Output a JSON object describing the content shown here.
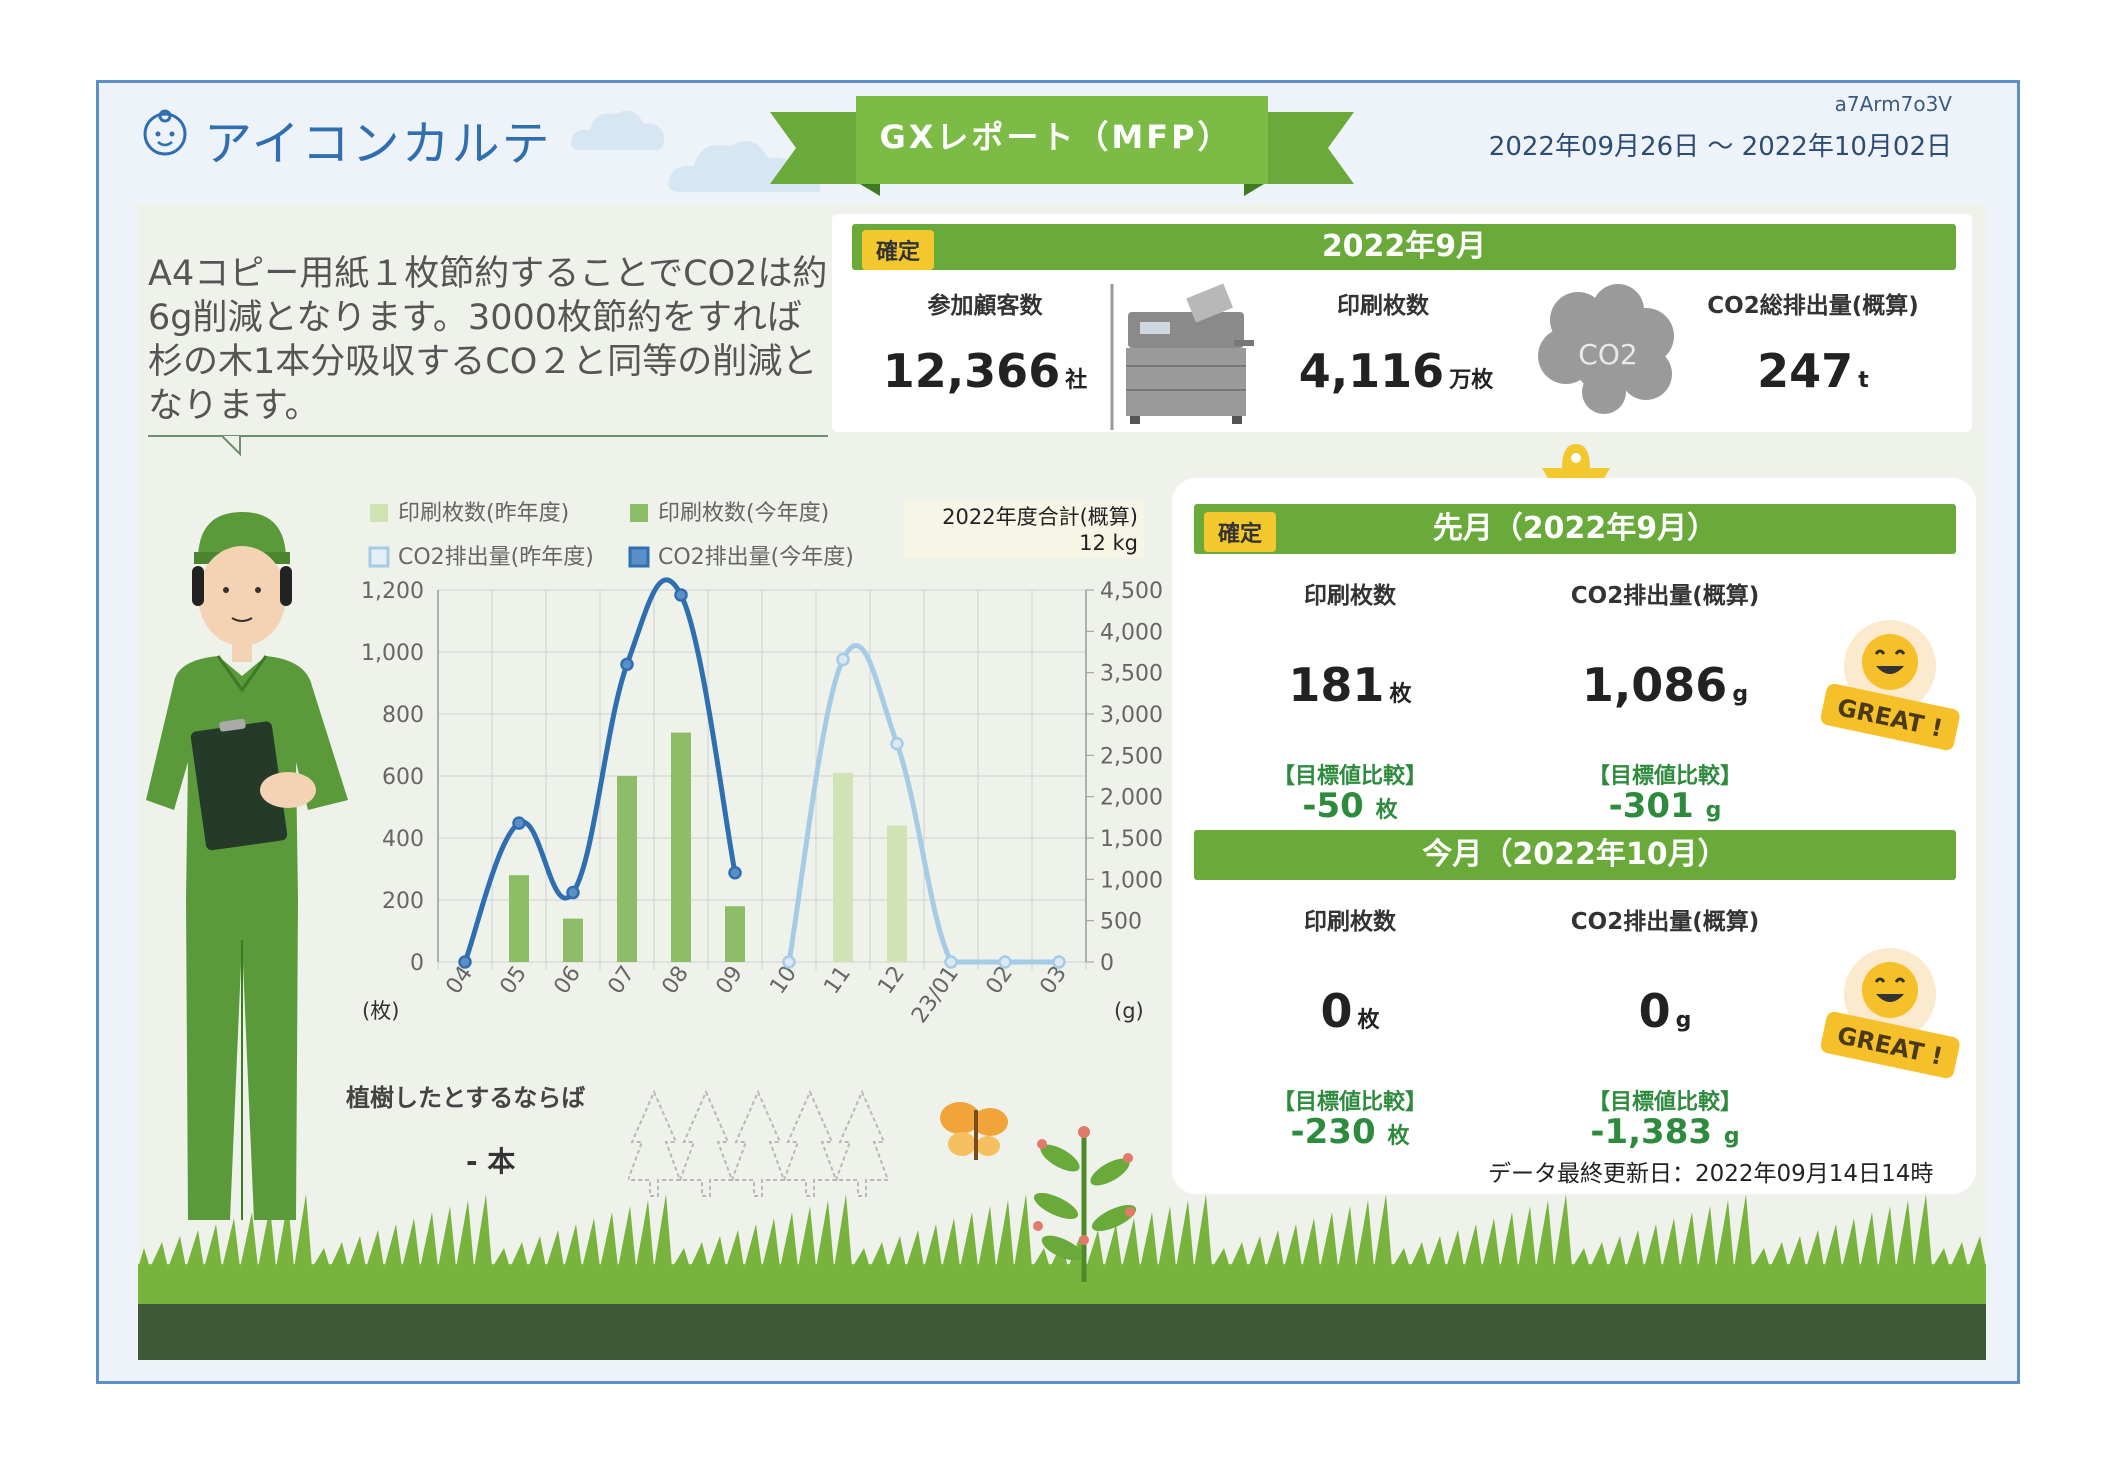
{
  "header": {
    "brand": "アイコンカルテ",
    "report_title": "GXレポート（MFP）",
    "report_id": "a7Arm7o3V",
    "date_range": "2022年09月26日 〜 2022年10月02日"
  },
  "message": "A4コピー用紙１枚節約することでCO2は約6g削減となります。3000枚節約をすれば杉の木1本分吸収するCO２と同等の削減となります。",
  "summary": {
    "badge": "確定",
    "period": "2022年9月",
    "customers_label": "参加顧客数",
    "customers_value": "12,366",
    "customers_unit": "社",
    "prints_label": "印刷枚数",
    "prints_value": "4,116",
    "prints_unit": "万枚",
    "co2_label": "CO2総排出量(概算)",
    "co2_value": "247",
    "co2_unit": "t",
    "cloud_text": "CO2"
  },
  "chart": {
    "legend": [
      "印刷枚数(昨年度)",
      "印刷枚数(今年度)",
      "CO2排出量(昨年度)",
      "CO2排出量(今年度)"
    ],
    "total_label": "2022年度合計(概算)",
    "total_value": "12 kg",
    "left_unit": "(枚)",
    "right_unit": "(g)",
    "colors": {
      "bar_prev": "#cfe3b4",
      "bar_curr": "#8dbd67",
      "line_prev": "#a6cbe6",
      "line_curr": "#2f6fb0"
    }
  },
  "chart_data": {
    "type": "bar",
    "categories": [
      "04",
      "05",
      "06",
      "07",
      "08",
      "09",
      "10",
      "11",
      "12",
      "23/01",
      "02",
      "03"
    ],
    "series": [
      {
        "name": "印刷枚数(昨年度)",
        "type": "bar",
        "axis": "left",
        "values": [
          null,
          null,
          null,
          null,
          null,
          null,
          null,
          610,
          440,
          null,
          null,
          null
        ]
      },
      {
        "name": "印刷枚数(今年度)",
        "type": "bar",
        "axis": "left",
        "values": [
          null,
          280,
          140,
          600,
          740,
          180,
          null,
          null,
          null,
          null,
          null,
          null
        ]
      },
      {
        "name": "CO2排出量(昨年度)",
        "type": "line",
        "axis": "right",
        "values": [
          null,
          null,
          null,
          null,
          null,
          null,
          0,
          3660,
          2640,
          0,
          0,
          0
        ]
      },
      {
        "name": "CO2排出量(今年度)",
        "type": "line",
        "axis": "right",
        "values": [
          0,
          1680,
          840,
          3600,
          4440,
          1080,
          null,
          null,
          null,
          null,
          null,
          null
        ]
      }
    ],
    "ylim_left": [
      0,
      1200
    ],
    "yticks_left": [
      "0",
      "200",
      "400",
      "600",
      "800",
      "1,000",
      "1,200"
    ],
    "ylim_right": [
      0,
      4500
    ],
    "yticks_right": [
      "0",
      "500",
      "1,000",
      "1,500",
      "2,000",
      "2,500",
      "3,000",
      "3,500",
      "4,000",
      "4,500"
    ],
    "grid": true
  },
  "trees": {
    "label": "植樹したとするならば",
    "value": "- 本"
  },
  "last_month": {
    "badge": "確定",
    "title": "先月（2022年9月）",
    "prints_label": "印刷枚数",
    "prints_value": "181",
    "prints_unit": "枚",
    "co2_label": "CO2排出量(概算)",
    "co2_value": "1,086",
    "co2_unit": "g",
    "cmp_label": "【目標値比較】",
    "prints_cmp": "-50",
    "prints_cmp_unit": "枚",
    "co2_cmp": "-301",
    "co2_cmp_unit": "g",
    "great": "GREAT !"
  },
  "this_month": {
    "title": "今月（2022年10月）",
    "prints_label": "印刷枚数",
    "prints_value": "0",
    "prints_unit": "枚",
    "co2_label": "CO2排出量(概算)",
    "co2_value": "0",
    "co2_unit": "g",
    "cmp_label": "【目標値比較】",
    "prints_cmp": "-230",
    "prints_cmp_unit": "枚",
    "co2_cmp": "-1,383",
    "co2_cmp_unit": "g",
    "great": "GREAT !"
  },
  "footer": {
    "updated": "データ最終更新日：2022年09月14日14時"
  }
}
